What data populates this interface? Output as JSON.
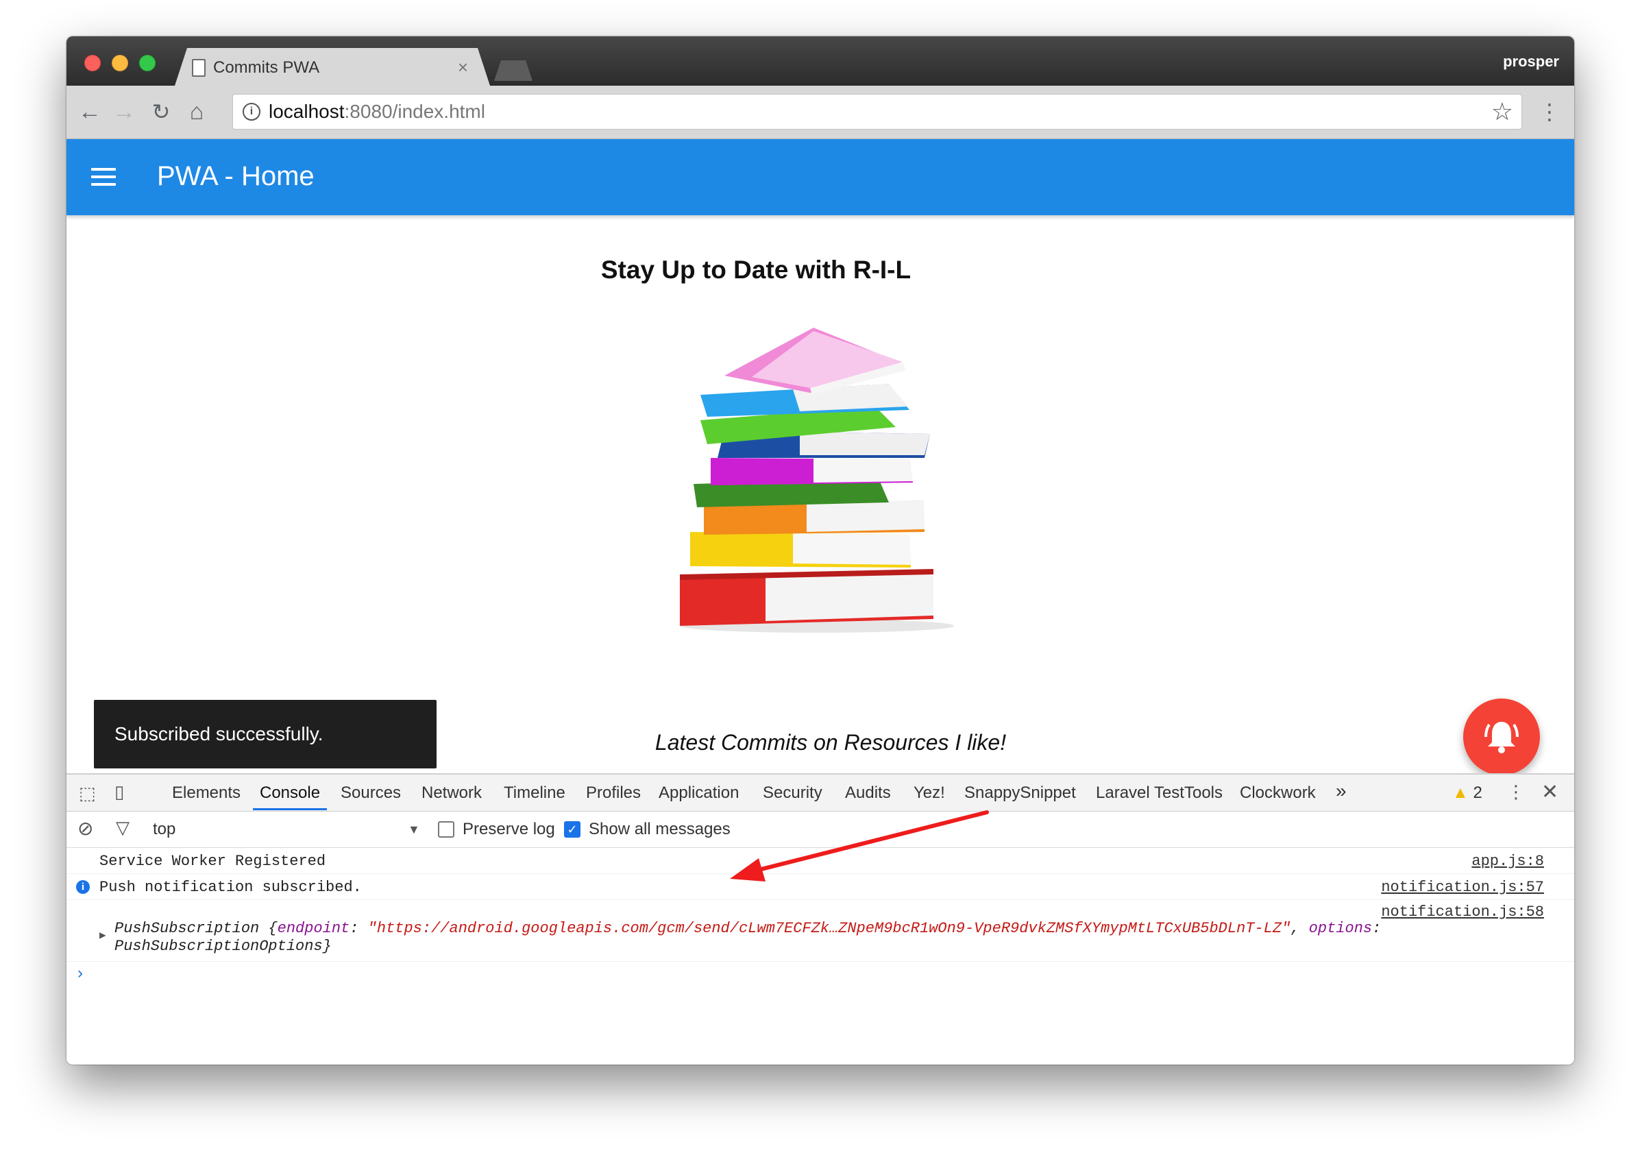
{
  "browser": {
    "tab_title": "Commits PWA",
    "profile": "prosper",
    "url_host": "localhost",
    "url_path": ":8080/index.html",
    "icons": [
      "back-icon",
      "forward-icon",
      "reload-icon",
      "home-icon",
      "info-icon",
      "star-icon",
      "menu-icon"
    ]
  },
  "app": {
    "title": "PWA - Home",
    "heading": "Stay Up to Date with R-I-L",
    "subtitle": "Latest Commits on Resources I like!",
    "snackbar": "Subscribed successfully.",
    "accent": "#1e88e5",
    "fab_color": "#f44336"
  },
  "devtools": {
    "tabs": [
      "Elements",
      "Console",
      "Sources",
      "Network",
      "Timeline",
      "Profiles",
      "Application",
      "Security",
      "Audits",
      "Yez!",
      "SnappySnippet",
      "Laravel TestTools",
      "Clockwork"
    ],
    "active_tab": "Console",
    "more": "»",
    "warnings": "2",
    "context": "top",
    "preserve_log": "Preserve log",
    "show_all": "Show all messages",
    "messages": [
      {
        "text": "Service Worker Registered",
        "source": "app.js:8"
      },
      {
        "text": "Push notification subscribed.",
        "source": "notification.js:57"
      },
      {
        "source": "notification.js:58",
        "prefix": "PushSubscription {",
        "key1": "endpoint",
        "value1": "\"https://android.googleapis.com/gcm/send/cLwm7ECFZk…ZNpeM9bcR1wOn9-VpeR9dvkZMSfXYmypMtLTCxUB5bDLnT-LZ\"",
        "key2": "options",
        "suffix": "PushSubscriptionOptions}"
      }
    ]
  }
}
